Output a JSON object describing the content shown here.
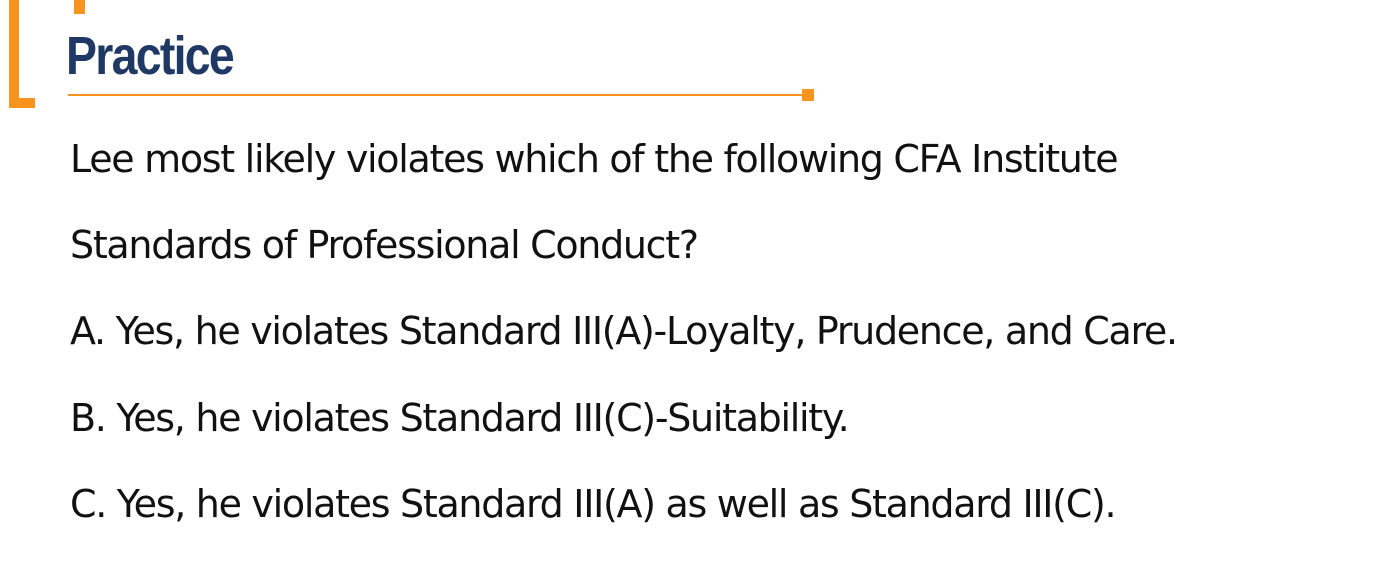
{
  "slide": {
    "title": "Practice",
    "accent_color": "#f7941d",
    "title_color": "#1f3864",
    "question": {
      "line1": "Lee most likely violates which of the following CFA Institute",
      "line2": "Standards of Professional Conduct?"
    },
    "options": [
      {
        "text": "A. Yes, he violates Standard III(A)-Loyalty, Prudence, and Care."
      },
      {
        "text": "B. Yes, he violates Standard III(C)-Suitability."
      },
      {
        "text": "C. Yes, he violates Standard III(A) as well as Standard III(C)."
      }
    ]
  }
}
